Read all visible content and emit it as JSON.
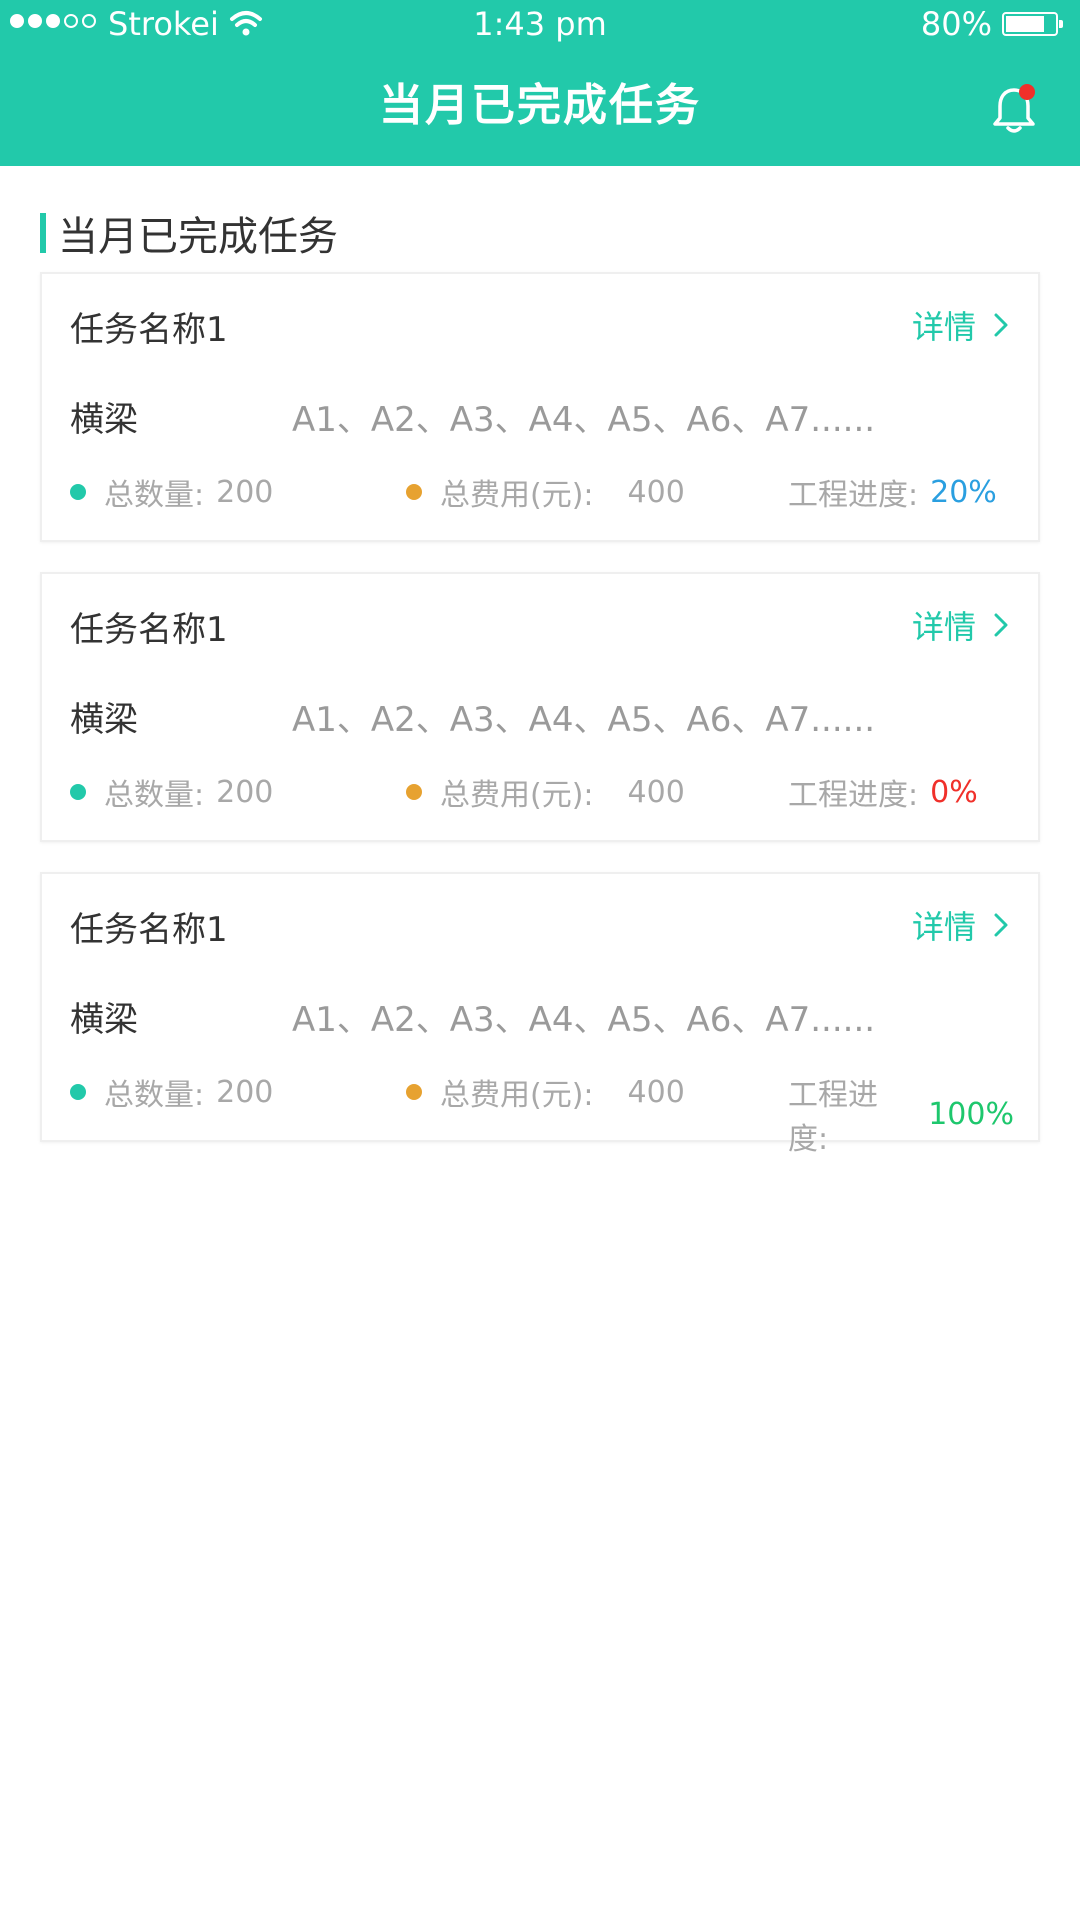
{
  "status_bar": {
    "carrier": "Strokei",
    "time": "1:43 pm",
    "battery_percent": "80%",
    "battery_level": 0.8,
    "signal_filled": 3,
    "signal_total": 5
  },
  "header": {
    "title": "当月已完成任务",
    "has_notification": true
  },
  "section": {
    "title": "当月已完成任务"
  },
  "colors": {
    "accent": "#22C9AA",
    "dot_total": "#22C9AA",
    "dot_cost": "#E7A230",
    "progress_20": "#2A9FE0",
    "progress_0": "#F0302A",
    "progress_100": "#1EC76D"
  },
  "tasks": [
    {
      "name": "任务名称1",
      "detail_label": "详情",
      "type_label": "横梁",
      "type_values": "A1、A2、A3、A4、A5、A6、A7......",
      "total_label": "总数量:",
      "total_value": "200",
      "cost_label": "总费用(元):",
      "cost_value": "400",
      "progress_label": "工程进度:",
      "progress_value": "20%",
      "progress_color": "#2A9FE0"
    },
    {
      "name": "任务名称1",
      "detail_label": "详情",
      "type_label": "横梁",
      "type_values": "A1、A2、A3、A4、A5、A6、A7......",
      "total_label": "总数量:",
      "total_value": "200",
      "cost_label": "总费用(元):",
      "cost_value": "400",
      "progress_label": "工程进度:",
      "progress_value": "0%",
      "progress_color": "#F0302A"
    },
    {
      "name": "任务名称1",
      "detail_label": "详情",
      "type_label": "横梁",
      "type_values": "A1、A2、A3、A4、A5、A6、A7......",
      "total_label": "总数量:",
      "total_value": "200",
      "cost_label": "总费用(元):",
      "cost_value": "400",
      "progress_label": "工程进度:",
      "progress_value": "100%",
      "progress_color": "#1EC76D"
    }
  ]
}
